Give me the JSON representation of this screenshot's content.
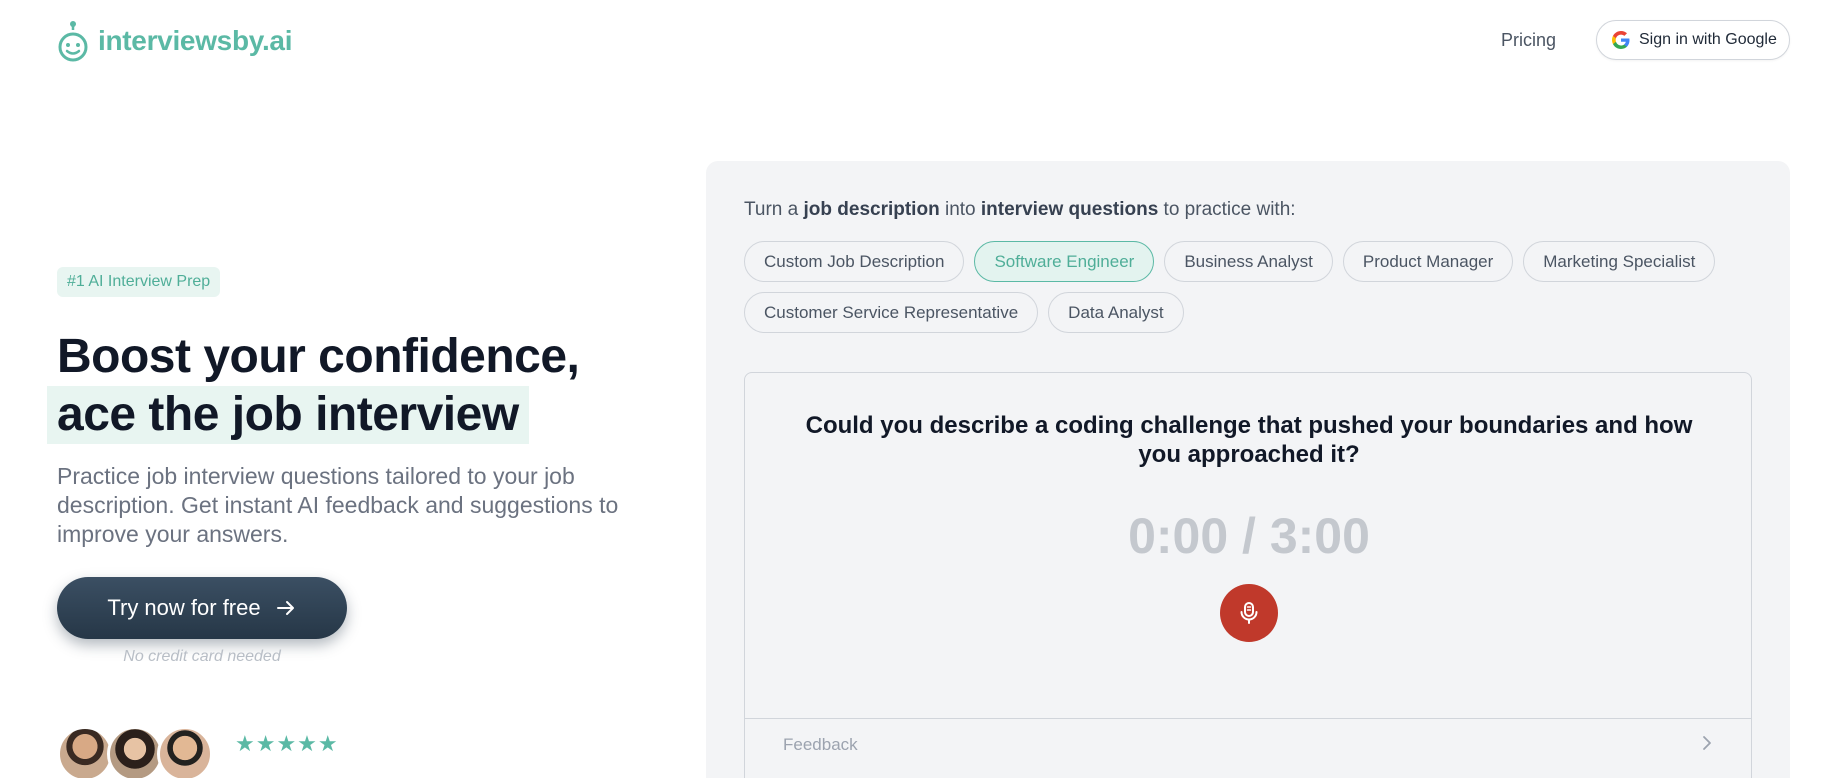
{
  "header": {
    "brand": "interviewsby.ai",
    "logo_icon": "robot-icon",
    "pricing_label": "Pricing",
    "google_label": "Sign in with Google",
    "google_icon": "google-icon"
  },
  "hero": {
    "badge": "#1 AI Interview Prep",
    "headline_line1": "Boost your confidence,",
    "headline_line2": "ace the job interview",
    "subtitle": "Practice job interview questions tailored to your job description. Get instant AI feedback and suggestions to improve your answers.",
    "cta_label": "Try now for free",
    "cta_icon": "arrow-right-icon",
    "cta_note": "No credit card needed",
    "rating_stars": "★★★★★",
    "rating_value": 5
  },
  "panel": {
    "prompt_pre": "Turn a ",
    "prompt_bold1": "job description",
    "prompt_mid": " into ",
    "prompt_bold2": "interview questions",
    "prompt_post": " to practice with:",
    "chips": [
      "Custom Job Description",
      "Software Engineer",
      "Business Analyst",
      "Product Manager",
      "Marketing Specialist",
      "Customer Service Representative",
      "Data Analyst"
    ],
    "active_chip": "Software Engineer",
    "question": "Could you describe a coding challenge that pushed your boundaries and how you approached it?",
    "timer": "0:00 / 3:00",
    "mic_icon": "microphone-icon",
    "feedback_label": "Feedback",
    "feedback_icon": "chevron-right-icon"
  },
  "colors": {
    "brand": "#5bb9a5",
    "cta_bg": "#263747",
    "mic_bg": "#c0392b",
    "badge_bg": "#e8f5f1"
  }
}
